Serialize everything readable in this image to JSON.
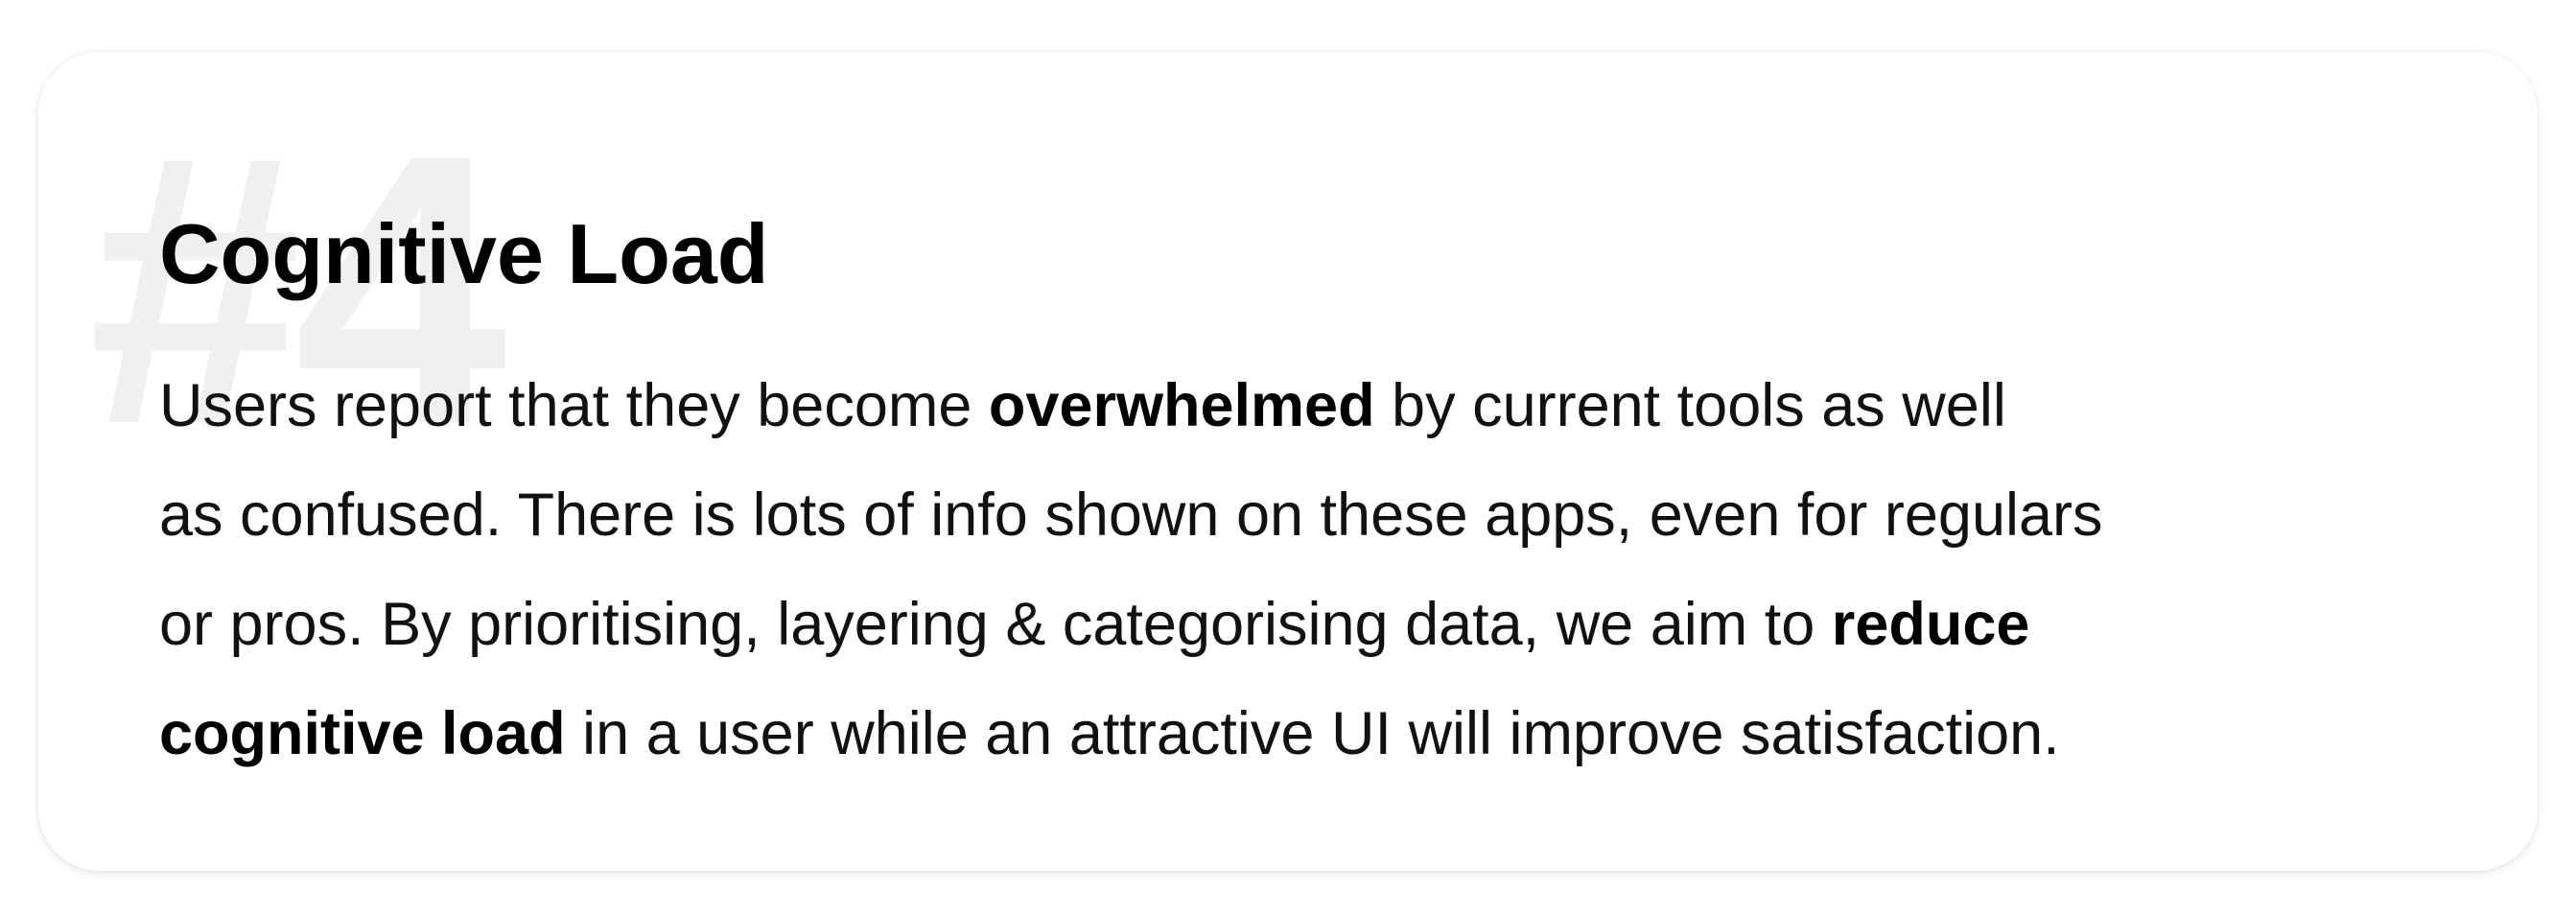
{
  "card": {
    "watermark": "#4",
    "title": "Cognitive Load",
    "body_lines": [
      [
        {
          "text": "Users report that they become ",
          "bold": false
        },
        {
          "text": "overwhelmed",
          "bold": true
        },
        {
          "text": " by current tools as well",
          "bold": false
        }
      ],
      [
        {
          "text": "as confused. There is lots of info shown on these apps, even for regulars",
          "bold": false
        }
      ],
      [
        {
          "text": "or pros. By prioritising, layering & categorising data, we aim to ",
          "bold": false
        },
        {
          "text": "reduce",
          "bold": true
        }
      ],
      [
        {
          "text": "cognitive load",
          "bold": true
        },
        {
          "text": " in a user while an attractive UI will improve satisfaction.",
          "bold": false
        }
      ]
    ]
  }
}
